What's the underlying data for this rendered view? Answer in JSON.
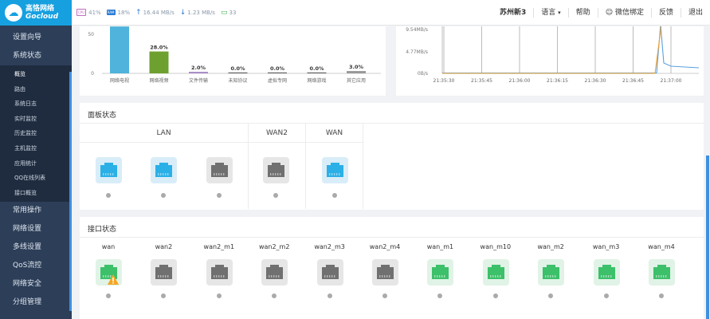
{
  "sidebar": {
    "logo_cn": "高恪网络",
    "logo_en": "Gocloud",
    "top_items": [
      "设置向导",
      "系统状态"
    ],
    "sub_items": [
      "概览",
      "路由",
      "系统日志",
      "实时监控",
      "历史监控",
      "主机监控",
      "应用统计",
      "QQ在线列表",
      "接口概览"
    ],
    "bottom_items": [
      "常用操作",
      "网络设置",
      "多线设置",
      "QoS流控",
      "网络安全",
      "分组管理"
    ]
  },
  "topbar": {
    "stats": [
      {
        "badge": "CPU",
        "value": "41%",
        "color": "#c06cc0"
      },
      {
        "badge": "RAM",
        "value": "18%",
        "color": "#2a7bd5"
      },
      {
        "icon": "↑",
        "value": "16.44 MB/s",
        "color": "#2a7bd5"
      },
      {
        "icon": "↓",
        "value": "1.23 MB/s",
        "color": "#2a7bd5"
      },
      {
        "icon": "▭",
        "value": "33",
        "color": "#3bb34a"
      }
    ],
    "location": "苏州新3",
    "language": "语言",
    "help": "帮助",
    "wechat": "微信绑定",
    "feedback": "反馈",
    "logout": "退出"
  },
  "chart_data": [
    {
      "type": "bar",
      "categories": [
        "网络电视",
        "网络视频",
        "文件传输",
        "未知协议",
        "虚拟专网",
        "网络游戏",
        "其它应用"
      ],
      "values": [
        0.0,
        28.0,
        2.0,
        0.0,
        0.0,
        0.0,
        3.0
      ],
      "data_labels": [
        "",
        "28.0%",
        "2.0%",
        "0.0%",
        "0.0%",
        "0.0%",
        "3.0%"
      ],
      "y_ticks": [
        "50",
        "0"
      ],
      "colors": [
        "#4fb3dc",
        "#6ea030",
        "#a98cc8",
        "#666",
        "#666",
        "#666",
        "#999"
      ]
    },
    {
      "type": "line",
      "x_ticks": [
        "21:35:30",
        "21:35:45",
        "21:36:00",
        "21:36:15",
        "21:36:30",
        "21:36:45",
        "21:37:00"
      ],
      "y_ticks": [
        "9.54MB/s",
        "4.77MB/s",
        "0B/s"
      ],
      "series": [
        {
          "color": "#5aa0e0"
        },
        {
          "color": "#f0a030"
        }
      ]
    }
  ],
  "panel": {
    "title": "面板状态",
    "groups": [
      {
        "name": "LAN",
        "ports": [
          "blue",
          "blue",
          "gray"
        ]
      },
      {
        "name": "WAN2",
        "ports": [
          "gray"
        ]
      },
      {
        "name": "WAN",
        "ports": [
          "blue"
        ]
      }
    ]
  },
  "interfaces": {
    "title": "接口状态",
    "items": [
      {
        "name": "wan",
        "state": "green-warn"
      },
      {
        "name": "wan2",
        "state": "gray"
      },
      {
        "name": "wan2_m1",
        "state": "gray"
      },
      {
        "name": "wan2_m2",
        "state": "gray"
      },
      {
        "name": "wan2_m3",
        "state": "gray"
      },
      {
        "name": "wan2_m4",
        "state": "gray"
      },
      {
        "name": "wan_m1",
        "state": "green"
      },
      {
        "name": "wan_m10",
        "state": "green"
      },
      {
        "name": "wan_m2",
        "state": "green"
      },
      {
        "name": "wan_m3",
        "state": "green"
      },
      {
        "name": "wan_m4",
        "state": "green"
      }
    ]
  }
}
